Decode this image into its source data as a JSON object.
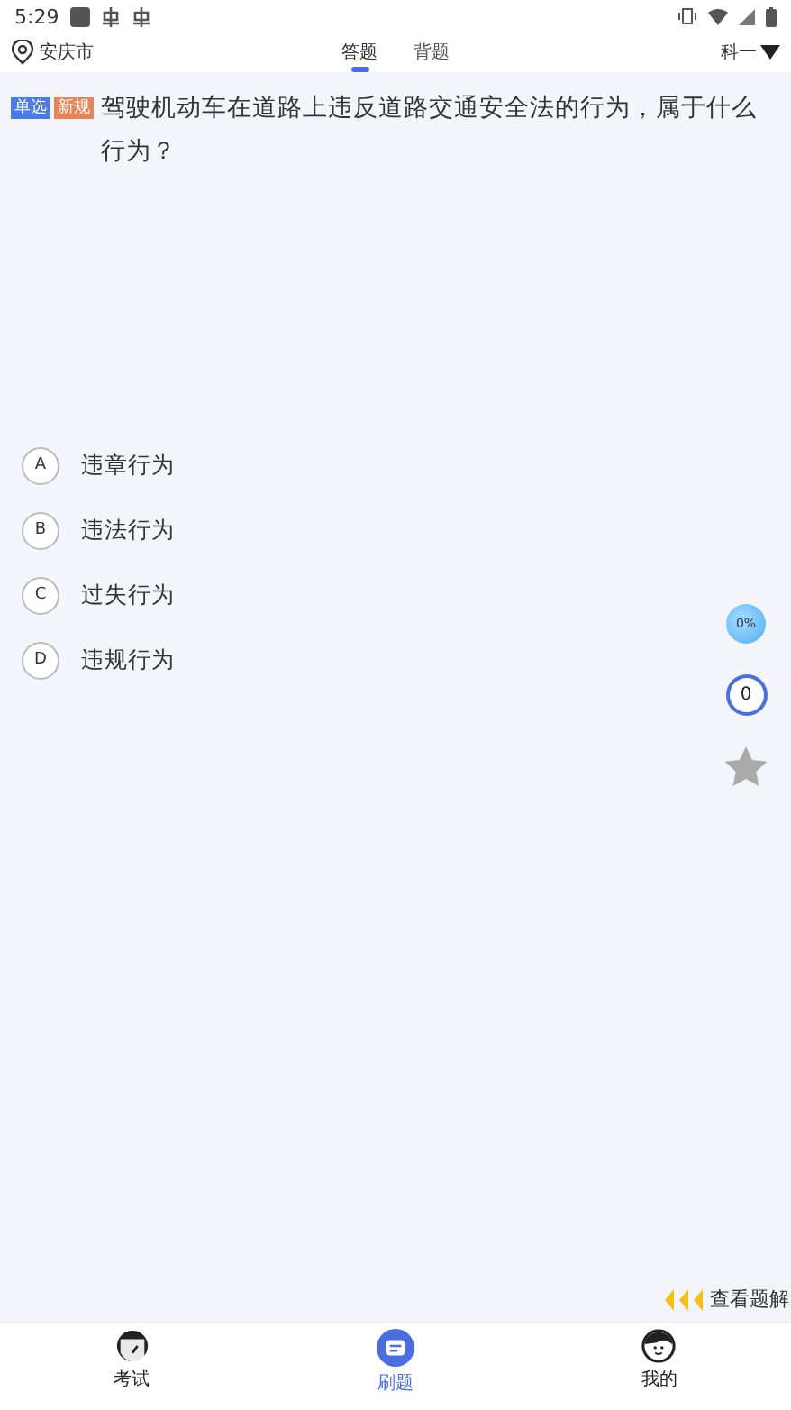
{
  "status_bar": {
    "time": "5:29"
  },
  "header": {
    "location": "安庆市",
    "tabs": [
      {
        "label": "答题",
        "selected": true
      },
      {
        "label": "背题",
        "selected": false
      }
    ],
    "subject": "科一"
  },
  "question": {
    "tags": [
      {
        "label": "单选",
        "color": "#4a7be8"
      },
      {
        "label": "新规",
        "color": "#e8845a"
      }
    ],
    "text": "驾驶机动车在道路上违反道路交通安全法的行为，属于什么行为？"
  },
  "options": [
    {
      "letter": "A",
      "text": "违章行为"
    },
    {
      "letter": "B",
      "text": "违法行为"
    },
    {
      "letter": "C",
      "text": "过失行为"
    },
    {
      "letter": "D",
      "text": "违规行为"
    }
  ],
  "side_tools": {
    "progress": "0%",
    "count": "0"
  },
  "explain_link": "查看题解",
  "bottom_nav": [
    {
      "label": "考试",
      "kind": "exam",
      "selected": false
    },
    {
      "label": "刷题",
      "kind": "practice",
      "selected": true
    },
    {
      "label": "我的",
      "kind": "mine",
      "selected": false
    }
  ]
}
